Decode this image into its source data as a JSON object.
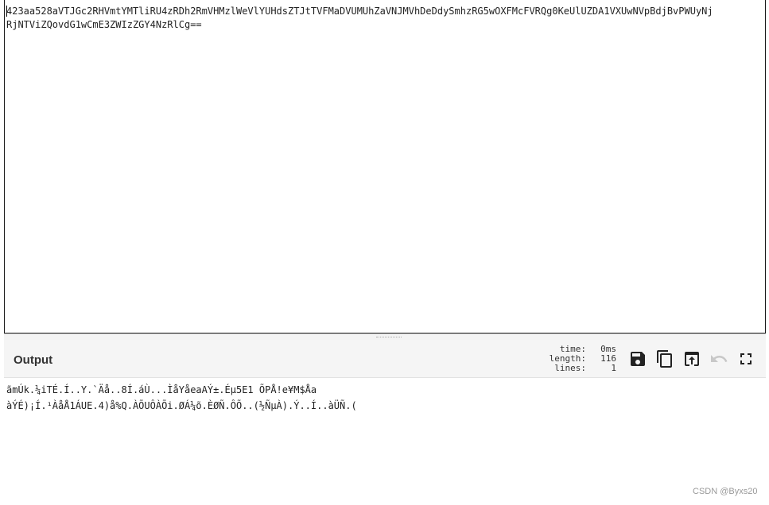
{
  "input": {
    "text_line1": "423aa528aVTJGc2RHVmtYMTliRU4zRDh2RmVHMzlWeVlYUHdsZTJtTVFMaDVUMUhZaVNJMVhDeDdySmhzRG5wOXFMcFVRQg0KeUlUZDA1VXUwNVpBdjBvPWUyNj",
    "text_line2": "RjNTViZQovdG1wCmE3ZWIzZGY4NzRlCg=="
  },
  "output": {
    "title": "Output",
    "stats": {
      "time_label": "time:",
      "time_value": "0ms",
      "length_label": "length:",
      "length_value": "116",
      "lines_label": "lines:",
      "lines_value": "1"
    },
    "text_line1": "ãmÚk.¼iTÉ.Í..Y.`Äå..8Í.áÙ...ÌåYåeaAÝ±.Éµ5E1 ÕPÅ!e¥M$Åa",
    "text_line2": "àÝÉ)¡Í.¹ÀåÅ1ÁUE.4)å%Q.ÀÕUÔÀÕi.ØÁ¼õ.ÈØÑ.ÔÕ..(½ÑµÀ).Ý..Í..àÜÑ.("
  },
  "watermark": "CSDN @Byxs20",
  "icons": [
    "save-icon",
    "copy-icon",
    "replace-input-icon",
    "undo-icon",
    "maximise-icon"
  ],
  "colors": {
    "header_bg": "#f5f5f5",
    "text": "#222222",
    "disabled_icon": "#c8c8c8"
  }
}
